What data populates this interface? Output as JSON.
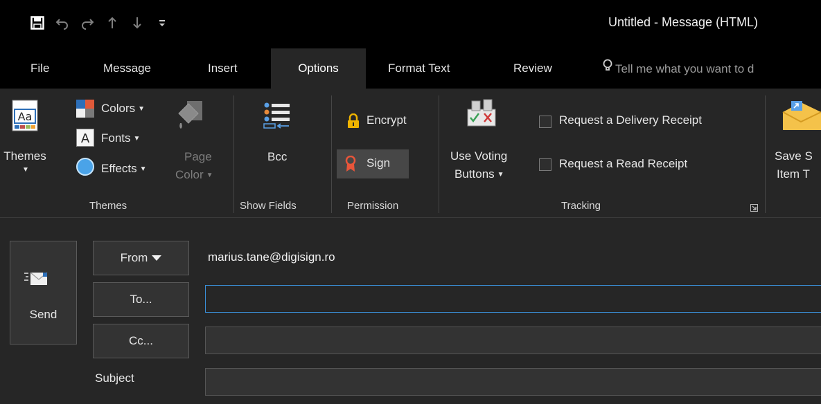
{
  "window": {
    "title": "Untitled - Message (HTML)"
  },
  "qat": {
    "save": "save-icon",
    "undo": "undo-icon",
    "redo": "redo-icon",
    "up": "arrow-up-icon",
    "down": "arrow-down-icon",
    "customize": "customize-icon"
  },
  "tabs": [
    {
      "label": "File"
    },
    {
      "label": "Message"
    },
    {
      "label": "Insert"
    },
    {
      "label": "Options"
    },
    {
      "label": "Format Text"
    },
    {
      "label": "Review"
    }
  ],
  "active_tab": "Options",
  "tell_me": {
    "placeholder": "Tell me what you want to d"
  },
  "ribbon": {
    "themes": {
      "themes_label": "Themes",
      "colors_label": "Colors",
      "fonts_label": "Fonts",
      "effects_label": "Effects",
      "page_color_line1": "Page",
      "page_color_line2": "Color",
      "group_label": "Themes"
    },
    "show_fields": {
      "bcc_label": "Bcc",
      "group_label": "Show Fields"
    },
    "permission": {
      "encrypt_label": "Encrypt",
      "sign_label": "Sign",
      "group_label": "Permission"
    },
    "tracking": {
      "voting_line1": "Use Voting",
      "voting_line2": "Buttons",
      "delivery_receipt_label": "Request a Delivery Receipt",
      "read_receipt_label": "Request a Read Receipt",
      "group_label": "Tracking"
    },
    "save_sent": {
      "line1": "Save S",
      "line2": "Item T"
    }
  },
  "compose": {
    "send_label": "Send",
    "from_label": "From",
    "from_value": "marius.tane@digisign.ro",
    "to_label": "To...",
    "cc_label": "Cc...",
    "subject_label": "Subject",
    "to_value": "",
    "cc_value": "",
    "subject_value": ""
  },
  "colors": {
    "accent_focus": "#3a8fd8",
    "titlebar_bg": "#000000",
    "ribbon_bg": "#262626",
    "sign_icon": "#e8553a",
    "encrypt_icon": "#f0b400"
  }
}
